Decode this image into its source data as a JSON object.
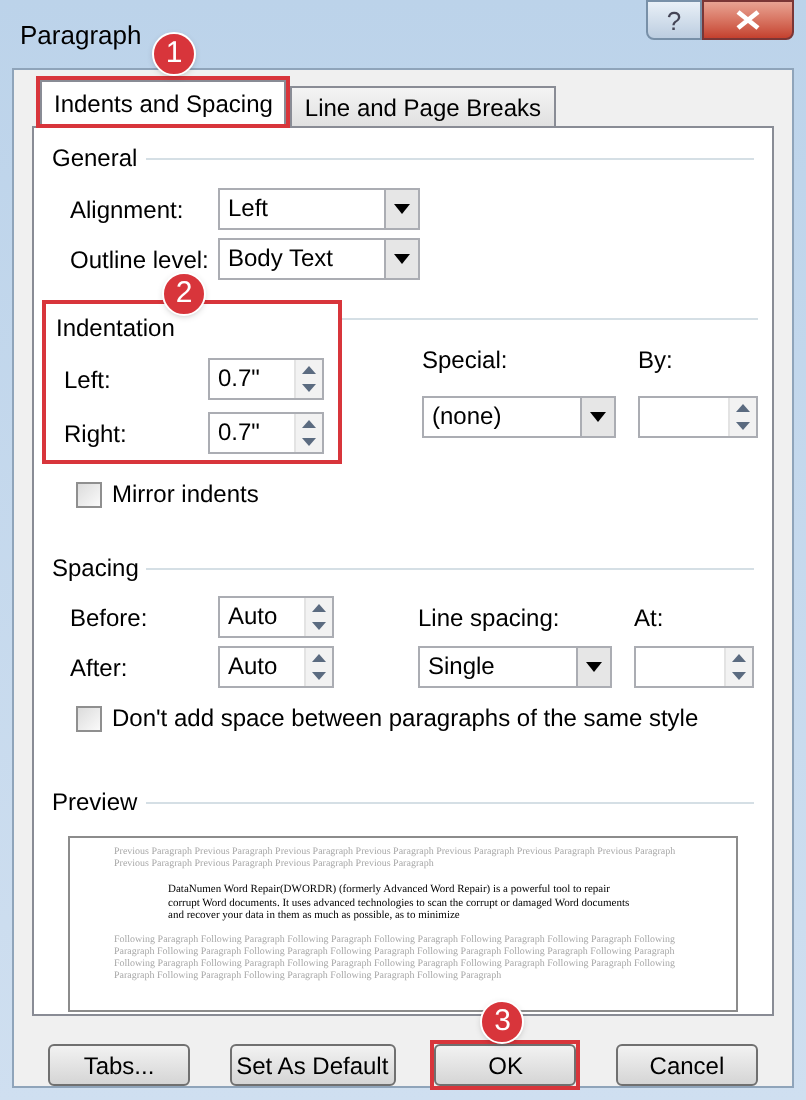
{
  "window": {
    "title": "Paragraph"
  },
  "title_buttons": [
    {
      "kind": "help",
      "label": "?"
    },
    {
      "kind": "close"
    }
  ],
  "tabs": [
    {
      "label": "Indents and Spacing",
      "selected": true,
      "highlighted": true,
      "callout": "1"
    },
    {
      "label": "Line and Page Breaks",
      "selected": false,
      "highlighted": false
    }
  ],
  "general": {
    "title": "General",
    "fields": [
      {
        "label": "Alignment:",
        "value": "Left"
      },
      {
        "label": "Outline level:",
        "value": "Body Text"
      }
    ]
  },
  "indentation": {
    "title": "Indentation",
    "highlighted": true,
    "callout": "2",
    "fields": [
      {
        "label": "Left:",
        "value": "0.7\""
      },
      {
        "label": "Right:",
        "value": "0.7\""
      }
    ],
    "special": {
      "label": "Special:",
      "value": "(none)"
    },
    "by": {
      "label": "By:"
    },
    "mirror": {
      "label": "Mirror indents",
      "checked": false
    }
  },
  "spacing": {
    "title": "Spacing",
    "fields": [
      {
        "label": "Before:",
        "value": "Auto"
      },
      {
        "label": "After:",
        "value": "Auto"
      }
    ],
    "line_spacing": {
      "label": "Line spacing:",
      "value": "Single"
    },
    "at": {
      "label": "At:"
    },
    "no_space": {
      "label": "Don't add space between paragraphs of the same style",
      "checked": false
    }
  },
  "preview": {
    "title": "Preview",
    "previous": "Previous Paragraph Previous Paragraph Previous Paragraph Previous Paragraph Previous Paragraph Previous Paragraph Previous Paragraph Previous Paragraph Previous Paragraph Previous Paragraph Previous Paragraph",
    "current": "DataNumen Word Repair(DWORDR) (formerly Advanced Word Repair) is a powerful tool to repair corrupt Word documents. It uses advanced technologies to scan the corrupt or damaged Word documents and recover your data in them as much as possible, as to minimize",
    "following": "Following Paragraph Following Paragraph Following Paragraph Following Paragraph Following Paragraph Following Paragraph Following Paragraph Following Paragraph Following Paragraph Following Paragraph Following Paragraph Following Paragraph Following Paragraph Following Paragraph Following Paragraph Following Paragraph Following Paragraph Following Paragraph Following Paragraph Following Paragraph Following Paragraph Following Paragraph Following Paragraph Following Paragraph"
  },
  "buttons": [
    {
      "label": "Tabs...",
      "highlighted": false
    },
    {
      "label": "Set As Default",
      "highlighted": false
    },
    {
      "label": "OK",
      "highlighted": true,
      "callout": "3"
    },
    {
      "label": "Cancel",
      "highlighted": false
    }
  ]
}
